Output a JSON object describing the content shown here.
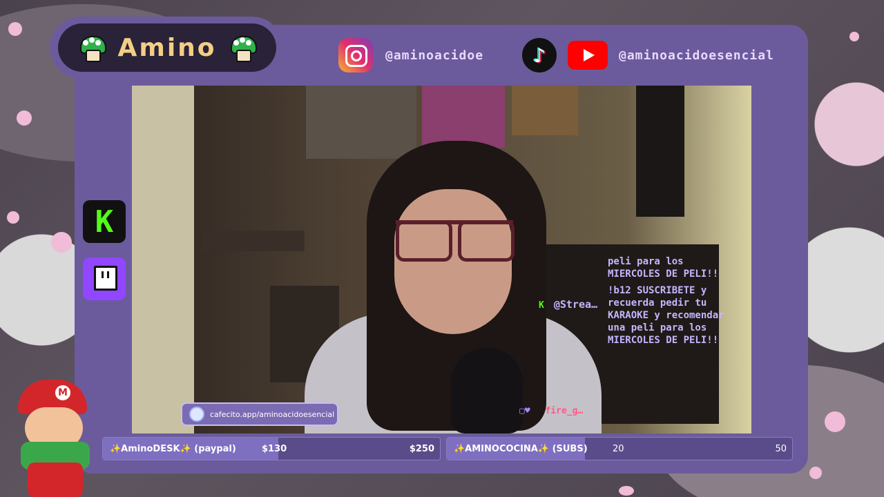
{
  "overlay": {
    "title": "Amino",
    "instagram_handle": "@aminoacidoe",
    "tiktok_youtube_handle": "@aminoacidoesencial",
    "cafecito_link": "cafecito.app/aminoacidoesencial"
  },
  "chat": {
    "message1": "peli para los MIERCOLES DE PELI!!",
    "user1": "@Strea…",
    "message2": "!b12 SUSCRIBETE y recuerda pedir tu KARAOKE y recomendar una peli para los MIERCOLES DE PELI!!",
    "user2": "fire_g…"
  },
  "goals": [
    {
      "label": "✨AminoDESK✨ (paypal)",
      "current": "$130",
      "target": "$250",
      "current_value": 130,
      "target_value": 250
    },
    {
      "label": "✨AMINOCOCINA✨ (SUBS)",
      "current": "20",
      "target": "50",
      "current_value": 20,
      "target_value": 50
    }
  ],
  "icons": {
    "instagram": "instagram-icon",
    "tiktok": "tiktok-icon",
    "youtube": "youtube-icon",
    "kick": "kick-icon",
    "twitch": "twitch-icon",
    "mushroom": "mushroom-icon"
  },
  "colors": {
    "frame": "#6b5b9c",
    "logo_bg": "#2a2238",
    "title": "#f3cf85",
    "chat_text": "#c4b6ff",
    "kick_green": "#53fc18",
    "twitch_purple": "#9146ff"
  }
}
